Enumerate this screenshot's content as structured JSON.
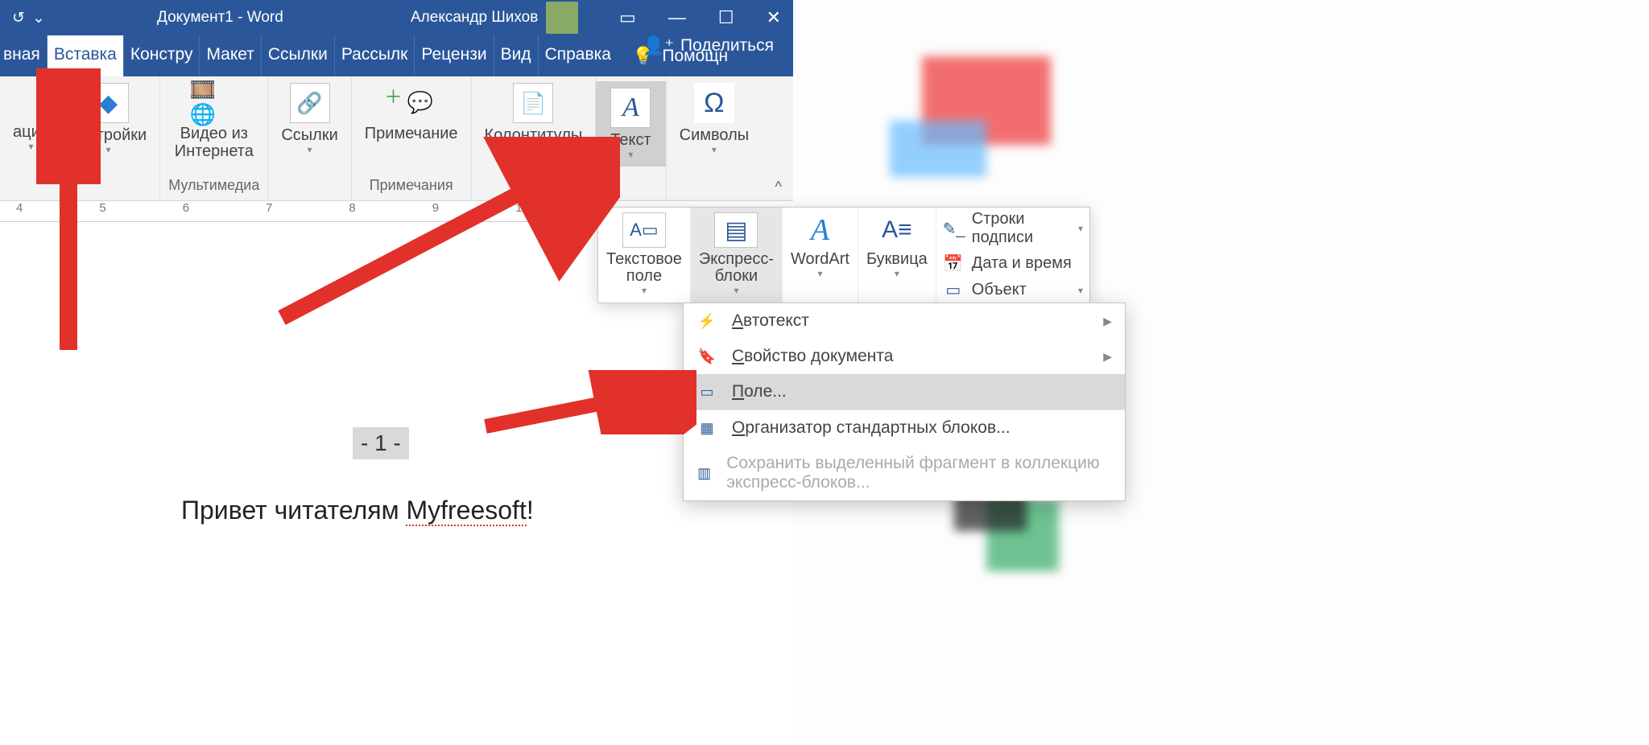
{
  "titlebar": {
    "doc_title": "Документ1  -  Word",
    "user_name": "Александр Шихов"
  },
  "tabs": {
    "t0": "вная",
    "t1": "Вставка",
    "t2": "Констру",
    "t3": "Макет",
    "t4": "Ссылки",
    "t5": "Рассылк",
    "t6": "Рецензи",
    "t7": "Вид",
    "t8": "Справка",
    "tell_me": "Помощн",
    "share": "Поделиться"
  },
  "ribbon": {
    "g0_btn1": "ации",
    "g0_btn2": "адстройки",
    "g1_btn1": "Видео из\nИнтернета",
    "g1_label": "Мультимедиа",
    "g2_btn1": "Ссылки",
    "g3_btn1": "Примечание",
    "g3_label": "Примечания",
    "g4_btn1": "Колонтитулы",
    "g5_btn1": "Текст",
    "g6_btn1": "Символы"
  },
  "ruler": {
    "n4": "4",
    "n5": "5",
    "n6": "6",
    "n7": "7",
    "n8": "8",
    "n9": "9",
    "n10": "10"
  },
  "doc": {
    "page_num": "- 1 -",
    "body_prefix": "Привет читателям ",
    "body_underlined": "Myfreesoft",
    "body_suffix": "!"
  },
  "text_popout": {
    "c1": "Текстовое\nполе",
    "c2": "Экспресс-\nблоки",
    "c3": "WordArt",
    "c4": "Буквица",
    "r1": "Строки подписи",
    "r2": "Дата и время",
    "r3": "Объект"
  },
  "menu": {
    "m1": "Автотекст",
    "m2": "Свойство документа",
    "m3": "Поле...",
    "m4": "Организатор стандартных блоков...",
    "m5": "Сохранить выделенный фрагмент в коллекцию экспресс-блоков..."
  }
}
